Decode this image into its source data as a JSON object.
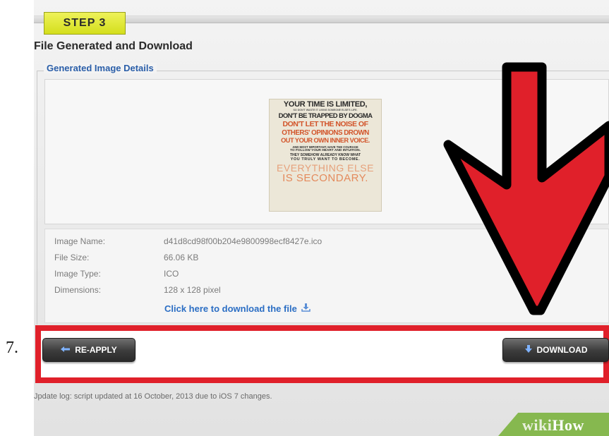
{
  "step": {
    "badge": "STEP 3"
  },
  "section": {
    "title": "File Generated and Download",
    "legend": "Generated Image Details"
  },
  "poster_lines": [
    "YOUR TIME IS LIMITED,",
    "SO DON'T WASTE IT LIVING SOMEONE ELSE'S LIFE.",
    "DON'T BE TRAPPED BY DOGMA",
    "DON'T LET THE NOISE OF",
    "OTHERS' OPINIONS DROWN",
    "OUT YOUR OWN INNER VOICE.",
    "AND MOST IMPORTANT, HAVE THE COURAGE",
    "TO FOLLOW YOUR HEART AND INTUITION.",
    "THEY SOMEHOW ALREADY KNOW WHAT",
    "YOU TRULY WANT TO BECOME.",
    "EVERYTHING ELSE",
    "IS SECONDARY."
  ],
  "details": {
    "name_label": "Image Name:",
    "name_value": "d41d8cd98f00b204e9800998ecf8427e.ico",
    "size_label": "File Size:",
    "size_value": "66.06 KB",
    "type_label": "Image Type:",
    "type_value": "ICO",
    "dim_label": "Dimensions:",
    "dim_value": "128 x 128 pixel",
    "download_link": "Click here to download the file"
  },
  "step_number": "7.",
  "buttons": {
    "reapply": "RE-APPLY",
    "download": "DOWNLOAD"
  },
  "update_log": "Jpdate log: script updated at 16 October, 2013 due to iOS 7 changes.",
  "brand": {
    "wiki": "wiki",
    "how": "How"
  },
  "colors": {
    "highlight_red": "#e0202a",
    "step_badge": "#e3e83a",
    "link_blue": "#2b6ec4",
    "brand_green": "#86b84f"
  }
}
